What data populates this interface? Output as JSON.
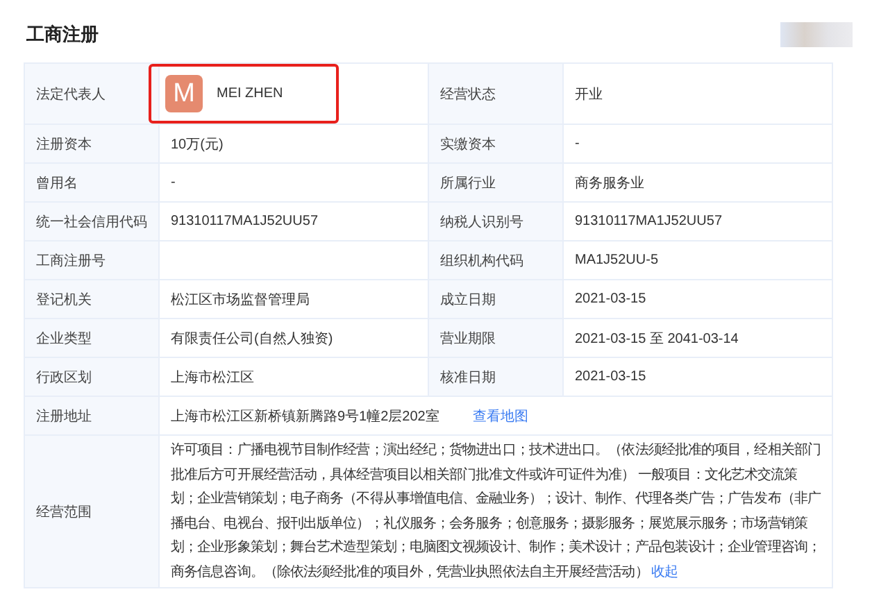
{
  "section_title": "工商注册",
  "rows": [
    {
      "kind": "pair",
      "cells": [
        {
          "label": "法定代表人",
          "kind": "person",
          "avatar_letter": "M",
          "value": "MEI ZHEN",
          "highlighted": true
        },
        {
          "label": "经营状态",
          "kind": "text",
          "value": "开业"
        }
      ]
    },
    {
      "kind": "pair",
      "cells": [
        {
          "label": "注册资本",
          "kind": "text",
          "value": "10万(元)"
        },
        {
          "label": "实缴资本",
          "kind": "text",
          "value": "-"
        }
      ]
    },
    {
      "kind": "pair",
      "cells": [
        {
          "label": "曾用名",
          "kind": "text",
          "value": "-"
        },
        {
          "label": "所属行业",
          "kind": "text",
          "value": "商务服务业"
        }
      ]
    },
    {
      "kind": "pair",
      "cells": [
        {
          "label": "统一社会信用代码",
          "kind": "text",
          "value": "91310117MA1J52UU57"
        },
        {
          "label": "纳税人识别号",
          "kind": "text",
          "value": "91310117MA1J52UU57"
        }
      ]
    },
    {
      "kind": "pair",
      "cells": [
        {
          "label": "工商注册号",
          "kind": "empty"
        },
        {
          "label": "组织机构代码",
          "kind": "text",
          "value": "MA1J52UU-5"
        }
      ]
    },
    {
      "kind": "pair",
      "cells": [
        {
          "label": "登记机关",
          "kind": "text",
          "value": "松江区市场监督管理局"
        },
        {
          "label": "成立日期",
          "kind": "text",
          "value": "2021-03-15"
        }
      ]
    },
    {
      "kind": "pair",
      "cells": [
        {
          "label": "企业类型",
          "kind": "text",
          "value": "有限责任公司(自然人独资)"
        },
        {
          "label": "营业期限",
          "kind": "text",
          "value": "2021-03-15 至 2041-03-14"
        }
      ]
    },
    {
      "kind": "pair",
      "cells": [
        {
          "label": "行政区划",
          "kind": "text",
          "value": "上海市松江区"
        },
        {
          "label": "核准日期",
          "kind": "text",
          "value": "2021-03-15"
        }
      ]
    },
    {
      "kind": "address",
      "label": "注册地址",
      "value": "上海市松江区新桥镇新腾路9号1幢2层202室",
      "link": "查看地图"
    },
    {
      "kind": "scope",
      "label": "经营范围",
      "value": "许可项目：广播电视节目制作经营；演出经纪；货物进出口；技术进出口。（依法须经批准的项目，经相关部门批准后方可开展经营活动，具体经营项目以相关部门批准文件或许可证件为准） 一般项目：文化艺术交流策划；企业营销策划；电子商务（不得从事增值电信、金融业务）；设计、制作、代理各类广告；广告发布（非广播电台、电视台、报刊出版单位）；礼仪服务；会务服务；创意服务；摄影服务；展览展示服务；市场营销策划；企业形象策划；舞台艺术造型策划；电脑图文视频设计、制作；美术设计；产品包装设计；企业管理咨询；商务信息咨询。（除依法须经批准的项目外，凭营业执照依法自主开展经营活动）",
      "link": "收起"
    }
  ]
}
